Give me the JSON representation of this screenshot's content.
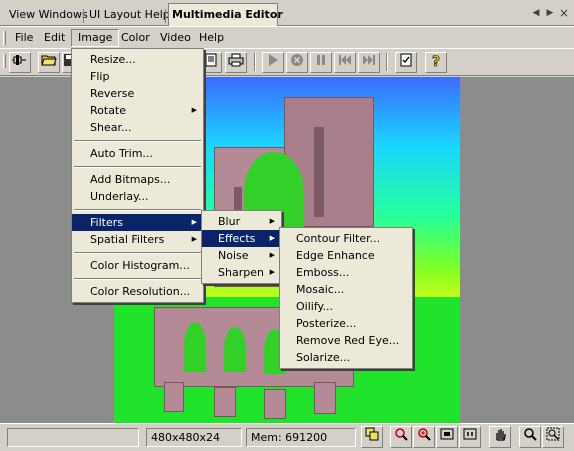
{
  "tabs": {
    "items": [
      "View Windows",
      "UI Layout Help",
      "Multimedia Editor"
    ],
    "active_index": 2,
    "controls": [
      "◀",
      "▶",
      "×"
    ]
  },
  "menubar": [
    "File",
    "Edit",
    "Image",
    "Color",
    "Video",
    "Help"
  ],
  "image_menu": {
    "resize": "Resize...",
    "flip": "Flip",
    "reverse": "Reverse",
    "rotate": "Rotate",
    "shear": "Shear...",
    "auto_trim": "Auto Trim...",
    "add_bitmaps": "Add Bitmaps...",
    "underlay": "Underlay...",
    "filters": "Filters",
    "spatial_filters": "Spatial Filters",
    "color_histogram": "Color Histogram...",
    "color_resolution": "Color Resolution..."
  },
  "filters_menu": {
    "blur": "Blur",
    "effects": "Effects",
    "noise": "Noise",
    "sharpen": "Sharpen"
  },
  "effects_menu": [
    "Contour Filter...",
    "Edge Enhance",
    "Emboss...",
    "Mosaic...",
    "Oilify...",
    "Posterize...",
    "Remove Red Eye...",
    "Solarize..."
  ],
  "toolbar_icons": [
    "pin-icon",
    "open-folder-icon",
    "save-icon",
    "print-preview-icon",
    "print-icon",
    "play-icon",
    "stop-icon",
    "pause-icon",
    "skip-back-icon",
    "skip-forward-icon",
    "properties-icon",
    "help-icon"
  ],
  "status": {
    "message": "",
    "dimensions": "480x480x24",
    "memory": "Mem: 691200"
  },
  "colors": {
    "menu_highlight": "#0a246a",
    "chrome": "#d4d0c8",
    "workspace": "#8c8c8c"
  }
}
